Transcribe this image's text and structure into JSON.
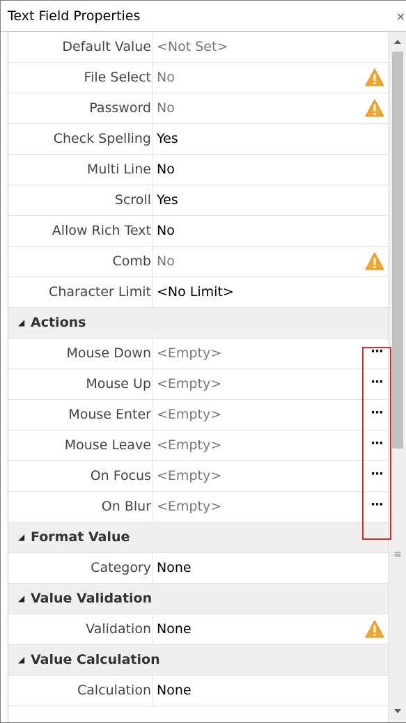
{
  "window": {
    "title": "Text Field Properties",
    "close_glyph": "×"
  },
  "rows": [
    {
      "type": "prop",
      "name": "Default Value",
      "value": "<Not Set>",
      "value_style": "gray"
    },
    {
      "type": "prop",
      "name": "File Select",
      "value": "No",
      "value_style": "gray",
      "warning": true
    },
    {
      "type": "prop",
      "name": "Password",
      "value": "No",
      "value_style": "gray",
      "warning": true
    },
    {
      "type": "prop",
      "name": "Check Spelling",
      "value": "Yes",
      "value_style": "black"
    },
    {
      "type": "prop",
      "name": "Multi Line",
      "value": "No",
      "value_style": "black"
    },
    {
      "type": "prop",
      "name": "Scroll",
      "value": "Yes",
      "value_style": "black"
    },
    {
      "type": "prop",
      "name": "Allow Rich Text",
      "value": "No",
      "value_style": "black"
    },
    {
      "type": "prop",
      "name": "Comb",
      "value": "No",
      "value_style": "gray",
      "warning": true
    },
    {
      "type": "prop",
      "name": "Character Limit",
      "value": "<No Limit>",
      "value_style": "black"
    },
    {
      "type": "category",
      "name": "Actions"
    },
    {
      "type": "prop",
      "name": "Mouse Down",
      "value": "<Empty>",
      "value_style": "gray",
      "ellipsis": "···"
    },
    {
      "type": "prop",
      "name": "Mouse Up",
      "value": "<Empty>",
      "value_style": "gray",
      "ellipsis": "···"
    },
    {
      "type": "prop",
      "name": "Mouse Enter",
      "value": "<Empty>",
      "value_style": "gray",
      "ellipsis": "···"
    },
    {
      "type": "prop",
      "name": "Mouse Leave",
      "value": "<Empty>",
      "value_style": "gray",
      "ellipsis": "···"
    },
    {
      "type": "prop",
      "name": "On Focus",
      "value": "<Empty>",
      "value_style": "gray",
      "ellipsis": "···"
    },
    {
      "type": "prop",
      "name": "On Blur",
      "value": "<Empty>",
      "value_style": "gray",
      "ellipsis": "···"
    },
    {
      "type": "category",
      "name": "Format Value"
    },
    {
      "type": "prop",
      "name": "Category",
      "value": "None",
      "value_style": "black"
    },
    {
      "type": "category",
      "name": "Value Validation"
    },
    {
      "type": "prop",
      "name": "Validation",
      "value": "None",
      "value_style": "black",
      "warning": true
    },
    {
      "type": "category",
      "name": "Value Calculation"
    },
    {
      "type": "prop",
      "name": "Calculation",
      "value": "None",
      "value_style": "black"
    }
  ],
  "icons": {
    "warning": "warning-icon",
    "collapse": "collapse-triangle-icon",
    "scroll_up": "scroll-up-arrow-icon",
    "scroll_down": "scroll-down-arrow-icon"
  },
  "colors": {
    "highlight": "#e02a2a",
    "warning_fill": "#f4a52a",
    "category_bg": "#f0f0f0"
  }
}
